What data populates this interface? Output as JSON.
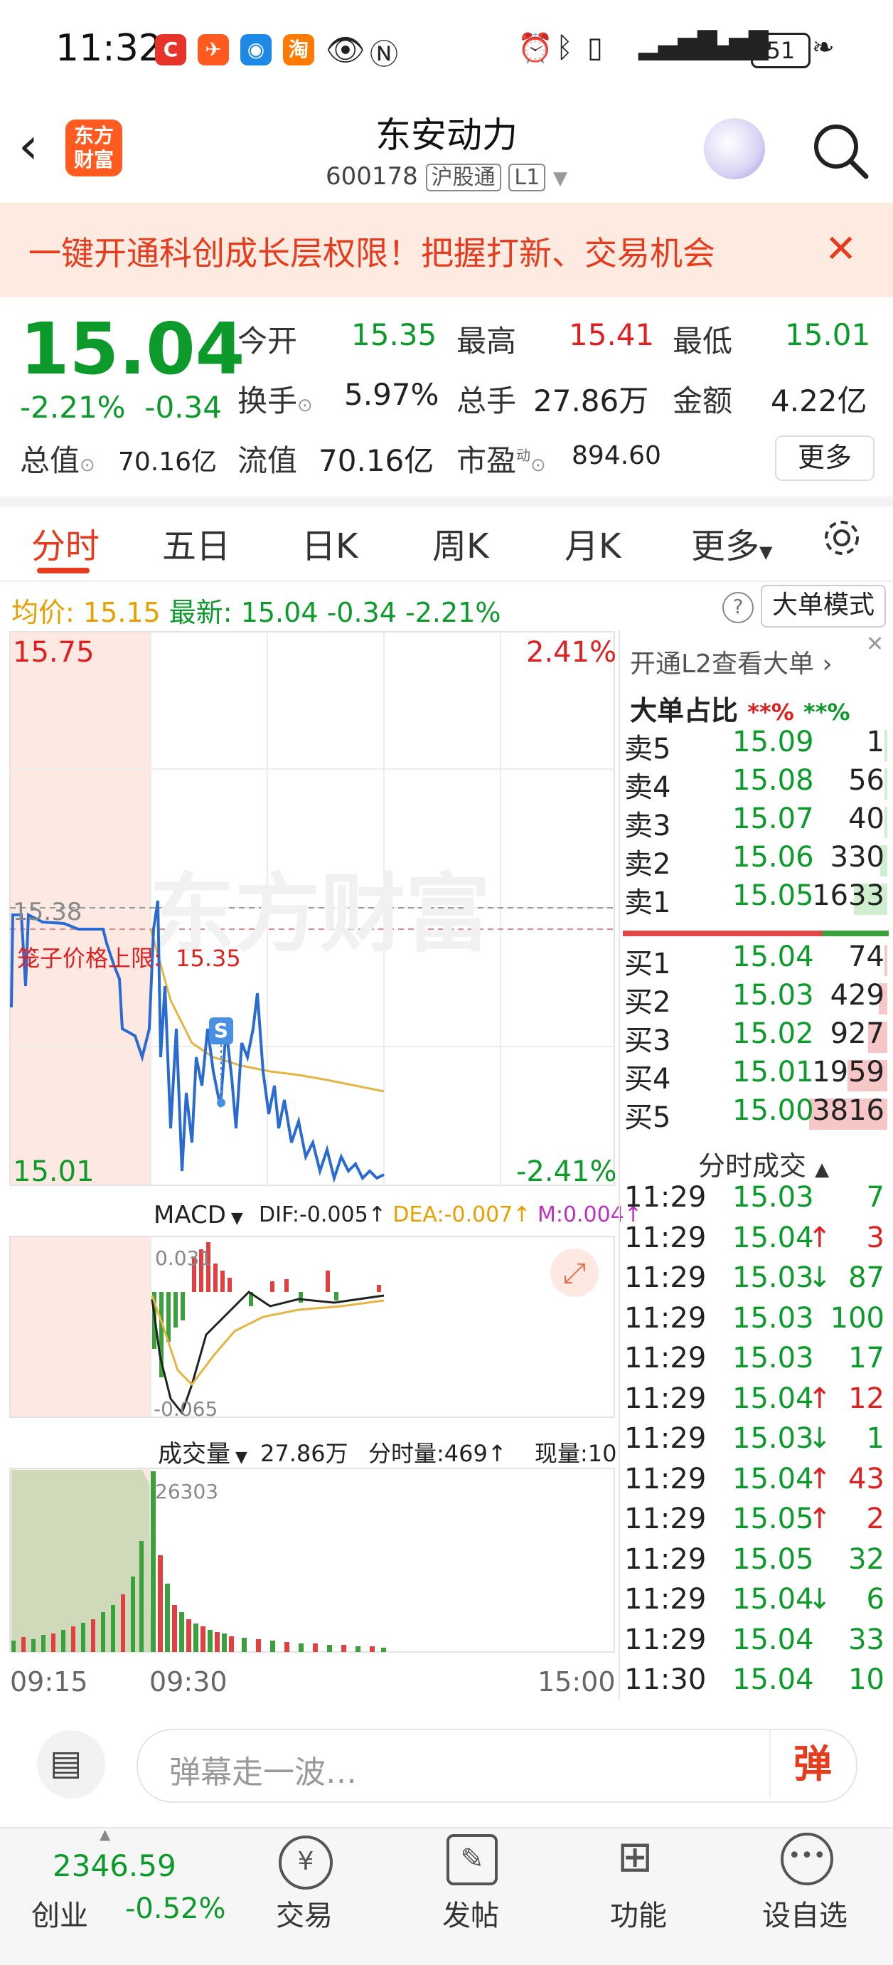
{
  "status": {
    "time": "11:32",
    "battery": "51"
  },
  "header": {
    "title": "东安动力",
    "code": "600178",
    "tag1": "沪股通",
    "tag2": "L1",
    "logo_line1": "东方",
    "logo_line2": "财富"
  },
  "banner": {
    "text": "一键开通科创成长层权限！把握打新、交易机会"
  },
  "quote": {
    "price": "15.04",
    "change_pct": "-2.21%",
    "change": "-0.34",
    "open_label": "今开",
    "open": "15.35",
    "high_label": "最高",
    "high": "15.41",
    "low_label": "最低",
    "low": "15.01",
    "turnover_label": "换手",
    "turnover": "5.97%",
    "vol_label": "总手",
    "vol": "27.86万",
    "amount_label": "金额",
    "amount": "4.22亿",
    "mktcap_label": "总值",
    "mktcap": "70.16亿",
    "float_label": "流值",
    "float": "70.16亿",
    "pe_label": "市盈",
    "pe_sup": "动",
    "pe": "894.60",
    "more": "更多"
  },
  "tabs": [
    "分时",
    "五日",
    "日K",
    "周K",
    "月K",
    "更多"
  ],
  "infoline": {
    "avg_label": "均价:",
    "avg": "15.15",
    "latest_label": "最新:",
    "latest": "15.04",
    "chg": "-0.34",
    "pct": "-2.21%",
    "mode": "大单模式"
  },
  "chart": {
    "top_price": "15.75",
    "top_pct": "2.41%",
    "bottom_price": "15.01",
    "bottom_pct": "-2.41%",
    "ref_price": "15.38",
    "limit_label": "笼子价格上限:",
    "limit_value": "15.35",
    "macd_label": "MACD",
    "dif": "DIF:-0.005↑",
    "dea": "DEA:-0.007↑",
    "m": "M:0.004↑",
    "macd_top": "0.031",
    "macd_bottom": "-0.065",
    "vol_label": "成交量",
    "vol_total": "27.86万",
    "vol_minute": "分时量:469↑",
    "vol_now": "现量:10",
    "vol_max": "26303",
    "time_start": "09:15",
    "time_mid": "09:30",
    "time_end": "15:00",
    "marker": "S"
  },
  "l2": {
    "promo": "开通L2查看大单 ›",
    "ratio_label": "大单占比",
    "ratio_buy": "**%",
    "ratio_sell": "**%"
  },
  "asks": [
    {
      "label": "卖5",
      "price": "15.09",
      "vol": "1"
    },
    {
      "label": "卖4",
      "price": "15.08",
      "vol": "56"
    },
    {
      "label": "卖3",
      "price": "15.07",
      "vol": "40"
    },
    {
      "label": "卖2",
      "price": "15.06",
      "vol": "330"
    },
    {
      "label": "卖1",
      "price": "15.05",
      "vol": "1633"
    }
  ],
  "bids": [
    {
      "label": "买1",
      "price": "15.04",
      "vol": "74"
    },
    {
      "label": "买2",
      "price": "15.03",
      "vol": "429"
    },
    {
      "label": "买3",
      "price": "15.02",
      "vol": "927"
    },
    {
      "label": "买4",
      "price": "15.01",
      "vol": "1959"
    },
    {
      "label": "买5",
      "price": "15.00",
      "vol": "3816"
    }
  ],
  "trades_title": "分时成交",
  "trades": [
    {
      "time": "11:29",
      "price": "15.03",
      "dir": "",
      "vol": "7",
      "color": "green"
    },
    {
      "time": "11:29",
      "price": "15.04",
      "dir": "↑",
      "vol": "3",
      "color": "red"
    },
    {
      "time": "11:29",
      "price": "15.03",
      "dir": "↓",
      "vol": "87",
      "color": "green"
    },
    {
      "time": "11:29",
      "price": "15.03",
      "dir": "",
      "vol": "100",
      "color": "green"
    },
    {
      "time": "11:29",
      "price": "15.03",
      "dir": "",
      "vol": "17",
      "color": "green"
    },
    {
      "time": "11:29",
      "price": "15.04",
      "dir": "↑",
      "vol": "12",
      "color": "red"
    },
    {
      "time": "11:29",
      "price": "15.03",
      "dir": "↓",
      "vol": "1",
      "color": "green"
    },
    {
      "time": "11:29",
      "price": "15.04",
      "dir": "↑",
      "vol": "43",
      "color": "red"
    },
    {
      "time": "11:29",
      "price": "15.05",
      "dir": "↑",
      "vol": "2",
      "color": "red"
    },
    {
      "time": "11:29",
      "price": "15.05",
      "dir": "",
      "vol": "32",
      "color": "green"
    },
    {
      "time": "11:29",
      "price": "15.04",
      "dir": "↓",
      "vol": "6",
      "color": "green"
    },
    {
      "time": "11:29",
      "price": "15.04",
      "dir": "",
      "vol": "33",
      "color": "green"
    },
    {
      "time": "11:30",
      "price": "15.04",
      "dir": "",
      "vol": "10",
      "color": "green"
    }
  ],
  "danmu": {
    "placeholder": "弹幕走一波…",
    "button": "弹"
  },
  "nav": {
    "index_value": "2346.59",
    "index_name": "创业",
    "index_pct": "-0.52%",
    "trade": "交易",
    "post": "发帖",
    "func": "功能",
    "watch": "设自选"
  }
}
